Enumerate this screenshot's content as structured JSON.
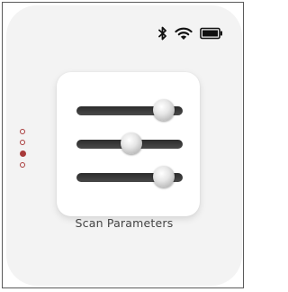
{
  "status_bar": {
    "icons": [
      "bluetooth-icon",
      "wifi-icon",
      "battery-icon"
    ],
    "battery_level": 1.0
  },
  "page_indicator": {
    "count": 4,
    "active_index": 2,
    "color": "#a83a3a"
  },
  "sliders": [
    {
      "name": "slider-1",
      "value": 0.82
    },
    {
      "name": "slider-2",
      "value": 0.52
    },
    {
      "name": "slider-3",
      "value": 0.82
    }
  ],
  "card": {
    "icon": "sliders-icon",
    "label": "Scan Parameters"
  }
}
